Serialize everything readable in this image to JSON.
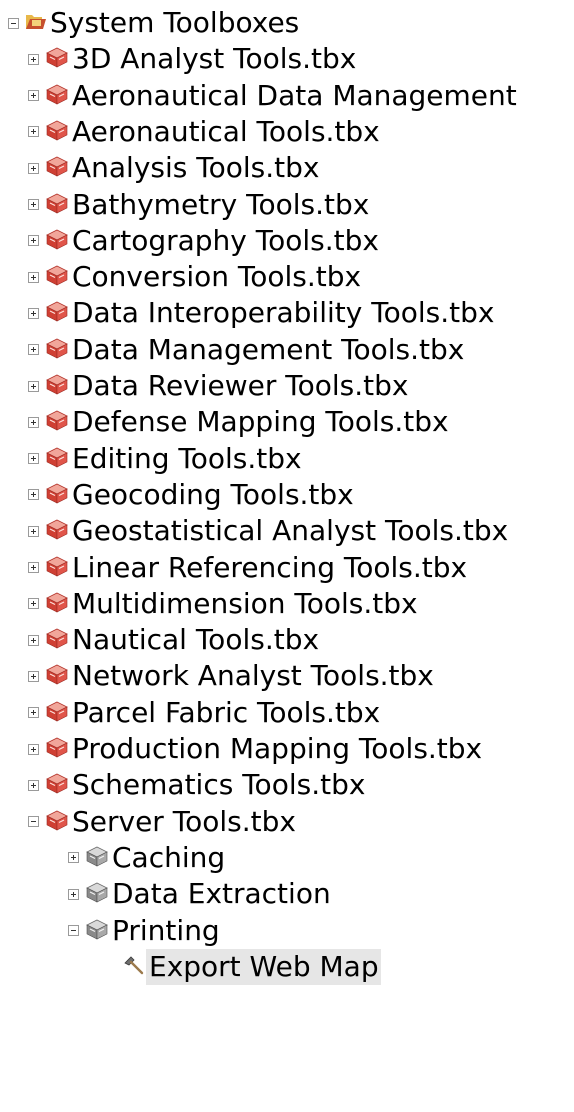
{
  "tree": {
    "root": {
      "label": "System Toolboxes",
      "expanded": true,
      "icon": "system-toolboxes-folder-icon"
    },
    "toolboxes": [
      {
        "label": "3D Analyst Tools.tbx",
        "expanded": false
      },
      {
        "label": "Aeronautical Data Management",
        "expanded": false
      },
      {
        "label": "Aeronautical Tools.tbx",
        "expanded": false
      },
      {
        "label": "Analysis Tools.tbx",
        "expanded": false
      },
      {
        "label": "Bathymetry Tools.tbx",
        "expanded": false
      },
      {
        "label": "Cartography Tools.tbx",
        "expanded": false
      },
      {
        "label": "Conversion Tools.tbx",
        "expanded": false
      },
      {
        "label": "Data Interoperability Tools.tbx",
        "expanded": false
      },
      {
        "label": "Data Management Tools.tbx",
        "expanded": false
      },
      {
        "label": "Data Reviewer Tools.tbx",
        "expanded": false
      },
      {
        "label": "Defense Mapping Tools.tbx",
        "expanded": false
      },
      {
        "label": "Editing Tools.tbx",
        "expanded": false
      },
      {
        "label": "Geocoding Tools.tbx",
        "expanded": false
      },
      {
        "label": "Geostatistical Analyst Tools.tbx",
        "expanded": false
      },
      {
        "label": "Linear Referencing Tools.tbx",
        "expanded": false
      },
      {
        "label": "Multidimension Tools.tbx",
        "expanded": false
      },
      {
        "label": "Nautical Tools.tbx",
        "expanded": false
      },
      {
        "label": "Network Analyst Tools.tbx",
        "expanded": false
      },
      {
        "label": "Parcel Fabric Tools.tbx",
        "expanded": false
      },
      {
        "label": "Production Mapping Tools.tbx",
        "expanded": false
      },
      {
        "label": "Schematics Tools.tbx",
        "expanded": false
      },
      {
        "label": "Server Tools.tbx",
        "expanded": true
      }
    ],
    "toolsets": [
      {
        "label": "Caching",
        "expanded": false
      },
      {
        "label": "Data Extraction",
        "expanded": false
      },
      {
        "label": "Printing",
        "expanded": true
      }
    ],
    "tools": [
      {
        "label": "Export Web Map",
        "selected": true,
        "icon": "hammer-tool-icon"
      }
    ]
  },
  "colors": {
    "toolbox_icon": "#d9534f",
    "toolset_icon": "#7a7a7a",
    "selection_bg": "#e6e6e6"
  }
}
